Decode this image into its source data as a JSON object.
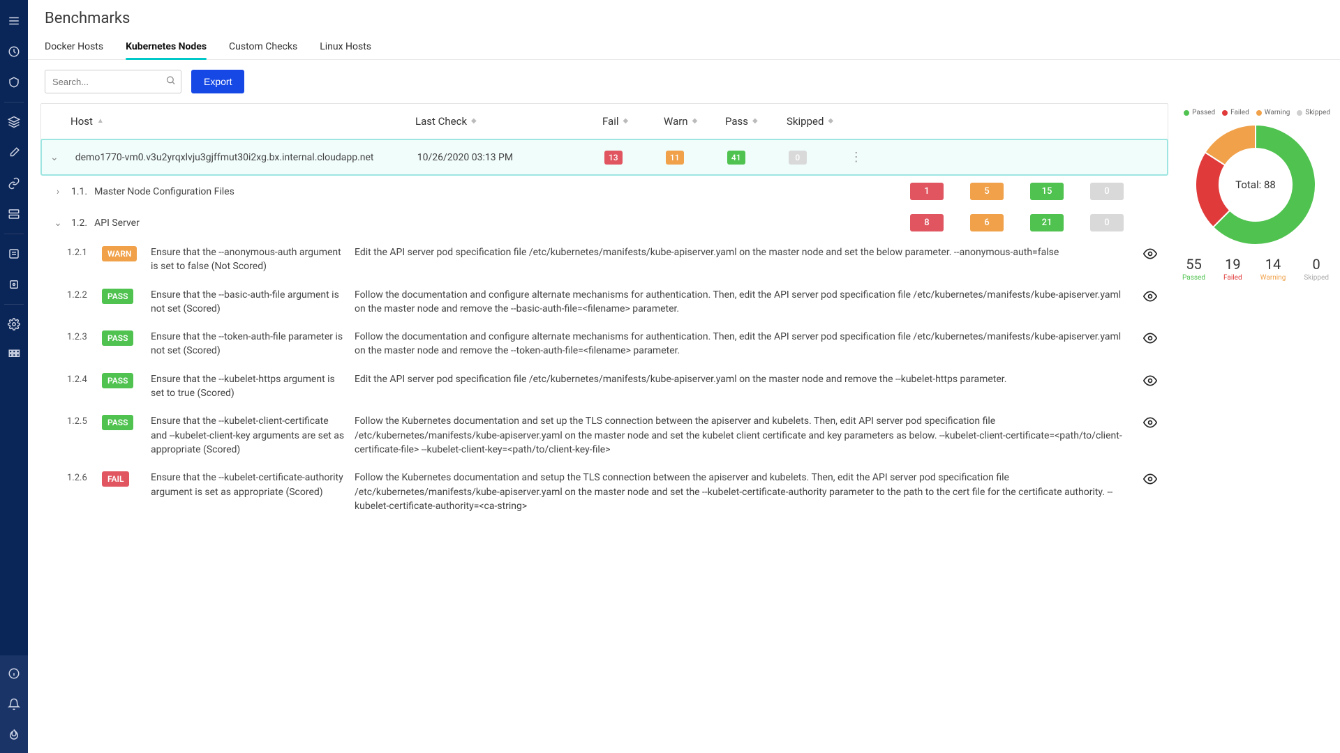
{
  "page_title": "Benchmarks",
  "tabs": [
    {
      "label": "Docker Hosts",
      "active": false
    },
    {
      "label": "Kubernetes Nodes",
      "active": true
    },
    {
      "label": "Custom Checks",
      "active": false
    },
    {
      "label": "Linux Hosts",
      "active": false
    }
  ],
  "search_placeholder": "Search...",
  "export_label": "Export",
  "columns": {
    "host": "Host",
    "last": "Last Check",
    "fail": "Fail",
    "warn": "Warn",
    "pass": "Pass",
    "skip": "Skipped"
  },
  "host_row": {
    "host": "demo1770-vm0.v3u2yrqxlvju3gjffmut30i2xg.bx.internal.cloudapp.net",
    "last": "10/26/2020 03:13 PM",
    "fail": "13",
    "warn": "11",
    "pass": "41",
    "skip": "0"
  },
  "groups": [
    {
      "id": "1.1.",
      "label": "Master Node Configuration Files",
      "fail": "1",
      "warn": "5",
      "pass": "15",
      "skip": "0",
      "expanded": false
    },
    {
      "id": "1.2.",
      "label": "API Server",
      "fail": "8",
      "warn": "6",
      "pass": "21",
      "skip": "0",
      "expanded": true
    }
  ],
  "details": [
    {
      "id": "1.2.1",
      "status": "WARN",
      "pill": "pill-warn",
      "title": "Ensure that the --anonymous-auth argument is set to false (Not Scored)",
      "desc": "Edit the API server pod specification file /etc/kubernetes/manifests/kube-apiserver.yaml on the master node and set the below parameter. --anonymous-auth=false"
    },
    {
      "id": "1.2.2",
      "status": "PASS",
      "pill": "pill-pass",
      "title": "Ensure that the --basic-auth-file argument is not set (Scored)",
      "desc": "Follow the documentation and configure alternate mechanisms for authentication. Then, edit the API server pod specification file /etc/kubernetes/manifests/kube-apiserver.yaml on the master node and remove the --basic-auth-file=<filename> parameter."
    },
    {
      "id": "1.2.3",
      "status": "PASS",
      "pill": "pill-pass",
      "title": "Ensure that the --token-auth-file parameter is not set (Scored)",
      "desc": "Follow the documentation and configure alternate mechanisms for authentication. Then, edit the API server pod specification file /etc/kubernetes/manifests/kube-apiserver.yaml on the master node and remove the --token-auth-file=<filename> parameter."
    },
    {
      "id": "1.2.4",
      "status": "PASS",
      "pill": "pill-pass",
      "title": "Ensure that the --kubelet-https argument is set to true (Scored)",
      "desc": "Edit the API server pod specification file /etc/kubernetes/manifests/kube-apiserver.yaml on the master node and remove the --kubelet-https parameter."
    },
    {
      "id": "1.2.5",
      "status": "PASS",
      "pill": "pill-pass",
      "title": "Ensure that the --kubelet-client-certificate and --kubelet-client-key arguments are set as appropriate (Scored)",
      "desc": "Follow the Kubernetes documentation and set up the TLS connection between the apiserver and kubelets. Then, edit API server pod specification file /etc/kubernetes/manifests/kube-apiserver.yaml on the master node and set the kubelet client certificate and key parameters as below. --kubelet-client-certificate=<path/to/client-certificate-file> --kubelet-client-key=<path/to/client-key-file>"
    },
    {
      "id": "1.2.6",
      "status": "FAIL",
      "pill": "pill-fail",
      "title": "Ensure that the --kubelet-certificate-authority argument is set as appropriate (Scored)",
      "desc": "Follow the Kubernetes documentation and setup the TLS connection between the apiserver and kubelets. Then, edit the API server pod specification file /etc/kubernetes/manifests/kube-apiserver.yaml on the master node and set the --kubelet-certificate-authority parameter to the path to the cert file for the certificate authority. --kubelet-certificate-authority=<ca-string>"
    }
  ],
  "legend": {
    "passed": "Passed",
    "failed": "Failed",
    "warning": "Warning",
    "skipped": "Skipped"
  },
  "donut_total_label": "Total: 88",
  "stats": {
    "passed": "55",
    "failed": "19",
    "warning": "14",
    "skipped": "0"
  },
  "chart_data": {
    "type": "pie",
    "title": "Total: 88",
    "series": [
      {
        "name": "Passed",
        "value": 55,
        "color": "#4fc24f"
      },
      {
        "name": "Failed",
        "value": 19,
        "color": "#e03a3a"
      },
      {
        "name": "Warning",
        "value": 14,
        "color": "#f0a14a"
      },
      {
        "name": "Skipped",
        "value": 0,
        "color": "#cfcfcf"
      }
    ]
  }
}
